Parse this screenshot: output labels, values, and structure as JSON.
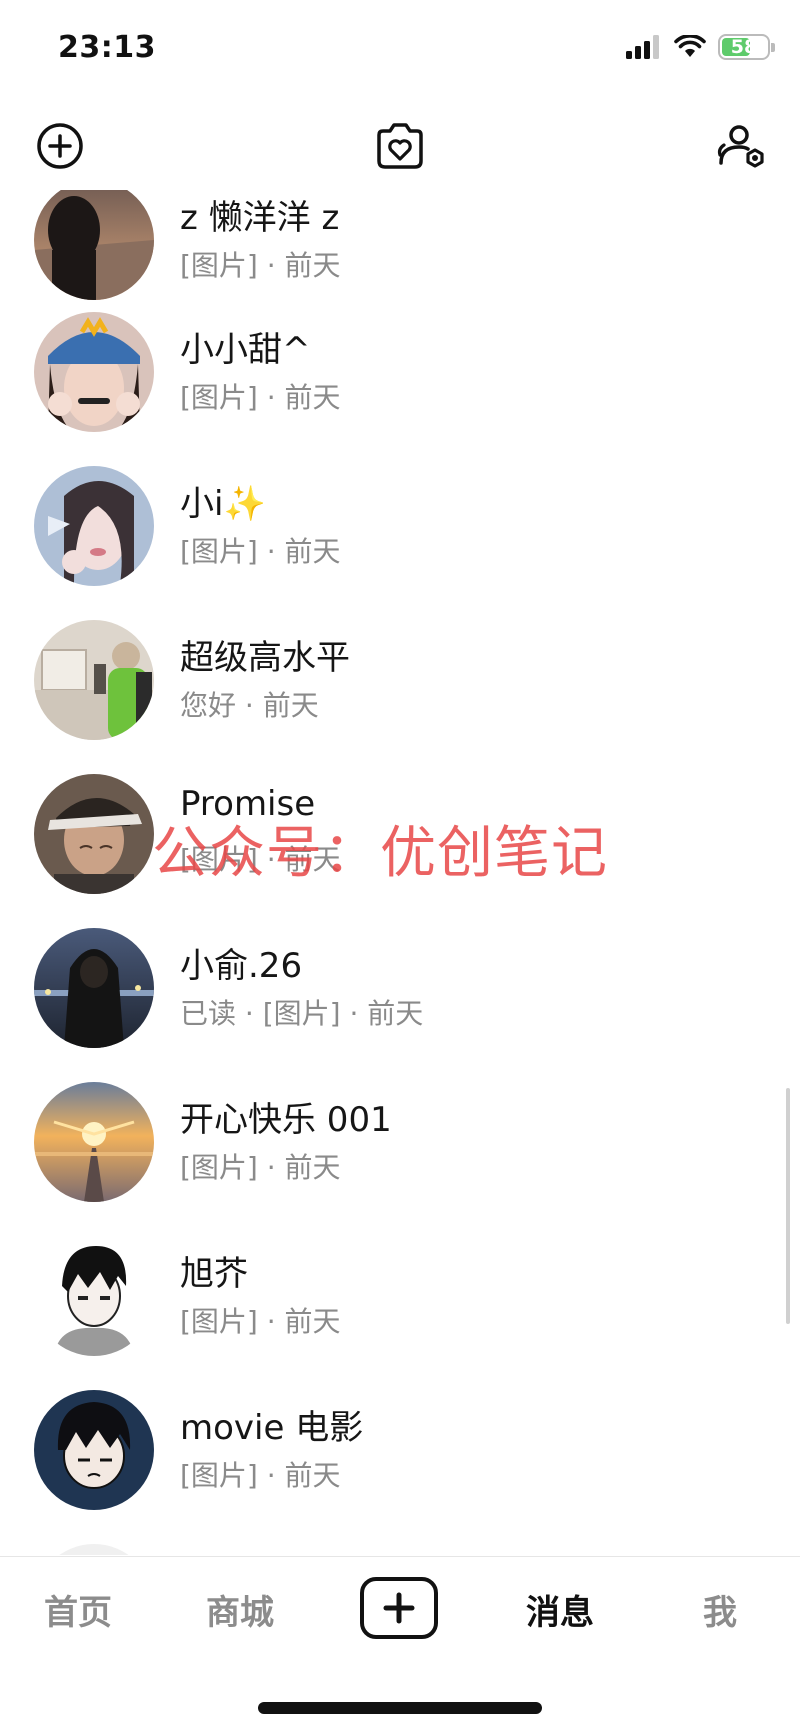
{
  "status_bar": {
    "time": "23:13",
    "battery": "58"
  },
  "top_nav": {
    "left_icon": "add-circle-icon",
    "center_icon": "heart-camera-icon",
    "right_icon": "contacts-settings-icon"
  },
  "conversations": [
    {
      "name": "z 懒洋洋 z",
      "preview": "[图片] · 前天"
    },
    {
      "name": "小小甜^",
      "preview": "[图片] · 前天"
    },
    {
      "name": "小i✨",
      "preview": "[图片] · 前天"
    },
    {
      "name": "超级高水平",
      "preview": "您好 · 前天"
    },
    {
      "name": "Promise",
      "preview": "[图片] · 前天"
    },
    {
      "name": "小俞.26",
      "preview": "已读 · [图片] · 前天"
    },
    {
      "name": "开心快乐 001",
      "preview": "[图片] · 前天"
    },
    {
      "name": "旭芥",
      "preview": "[图片] · 前天"
    },
    {
      "name": "movie 电影",
      "preview": "[图片] · 前天"
    }
  ],
  "watermark": "公众号：优创笔记",
  "tab_bar": {
    "home": "首页",
    "mall": "商城",
    "messages": "消息",
    "me": "我",
    "active": "消息"
  }
}
